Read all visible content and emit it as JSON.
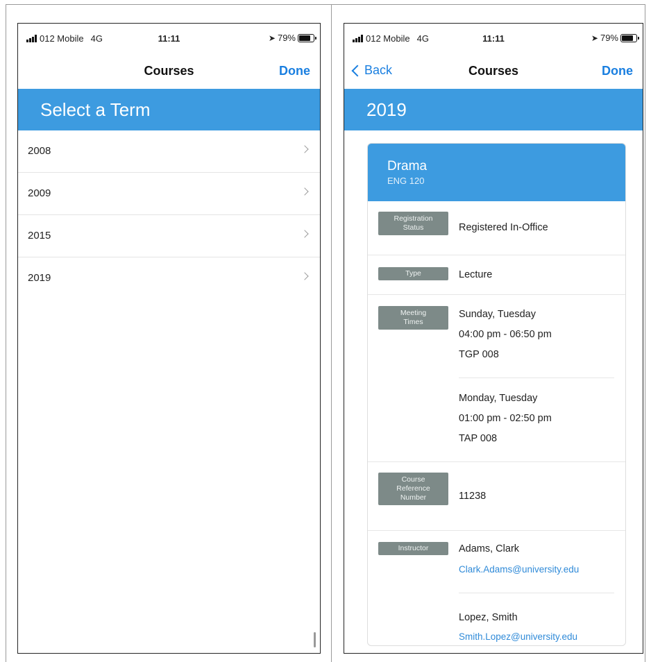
{
  "status_bar": {
    "carrier": "012 Mobile",
    "network": "4G",
    "time": "11:11",
    "battery": "79%"
  },
  "left_screen": {
    "nav_title": "Courses",
    "done_label": "Done",
    "banner_title": "Select a Term",
    "terms": [
      "2008",
      "2009",
      "2015",
      "2019"
    ]
  },
  "right_screen": {
    "back_label": "Back",
    "nav_title": "Courses",
    "done_label": "Done",
    "banner_title": "2019",
    "course": {
      "name": "Drama",
      "code": "ENG 120",
      "registration_status": {
        "label_line1": "Registration",
        "label_line2": "Status",
        "value": "Registered In-Office"
      },
      "type": {
        "label": "Type",
        "value": "Lecture"
      },
      "meeting_times": {
        "label_line1": "Meeting",
        "label_line2": "Times",
        "entries": [
          {
            "days": "Sunday, Tuesday",
            "time": "04:00 pm - 06:50 pm",
            "room": "TGP 008"
          },
          {
            "days": "Monday, Tuesday",
            "time": "01:00 pm - 02:50 pm",
            "room": "TAP 008"
          }
        ]
      },
      "crn": {
        "label_line1": "Course",
        "label_line2": "Reference",
        "label_line3": "Number",
        "value": "11238"
      },
      "instructors": {
        "label": "Instructor",
        "entries": [
          {
            "name": "Adams, Clark",
            "email": "Clark.Adams@university.edu"
          },
          {
            "name": "Lopez, Smith",
            "email": "Smith.Lopez@university.edu"
          }
        ]
      }
    }
  },
  "colors": {
    "banner": "#3d9be0",
    "link": "#1a7fe0",
    "tag": "#7d8a88"
  }
}
